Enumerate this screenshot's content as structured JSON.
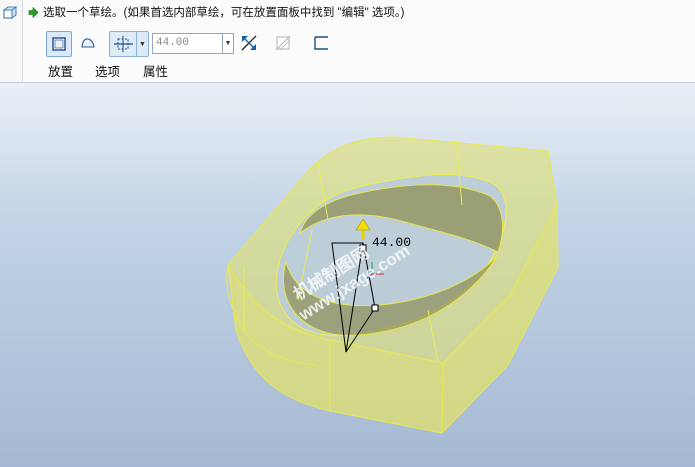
{
  "prompt": {
    "text": "选取一个草绘。(如果首选内部草绘，可在放置面板中找到 \"编辑\" 选项。)"
  },
  "toolbar": {
    "depth_value": "44.00",
    "icons": [
      "solid-icon",
      "surface-icon",
      "depth-blind-icon",
      "flip-direction-icon",
      "thicken-icon",
      "remove-material-icon"
    ]
  },
  "tabs": [
    {
      "label": "放置"
    },
    {
      "label": "选项"
    },
    {
      "label": "属性"
    }
  ],
  "viewport": {
    "dimension_label": "44.00",
    "watermark_line1": "机械制图网",
    "watermark_line2": "www.jxage.com",
    "model_color": "#e3e36a",
    "edge_color": "#e8e85a"
  }
}
